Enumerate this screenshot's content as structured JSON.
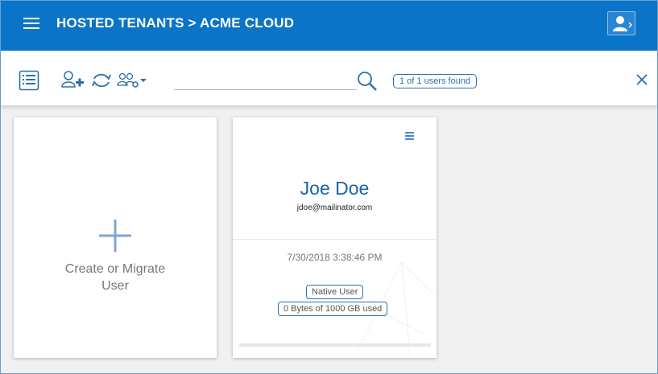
{
  "header": {
    "title": "HOSTED TENANTS > ACME CLOUD",
    "menu_icon": "hamburger-menu-icon",
    "user_icon": "user-account-icon"
  },
  "toolbar": {
    "icons": [
      "list-view-icon",
      "add-user-icon",
      "sync-icon",
      "group-settings-icon"
    ],
    "search": {
      "value": "",
      "placeholder": ""
    },
    "search_icon": "search-icon",
    "found_text": "1 of 1 users found",
    "close_icon": "close-icon"
  },
  "create_card": {
    "label_line1": "Create or Migrate",
    "label_line2": "User",
    "icon": "plus-icon"
  },
  "user_card": {
    "name": "Joe Doe",
    "email": "jdoe@mailinator.com",
    "date": "7/30/2018 3:38:46 PM",
    "type_badge": "Native User",
    "storage_badge": "0 Bytes of 1000 GB used",
    "menu_icon": "card-menu-icon"
  },
  "colors": {
    "header_bg": "#0a74c8",
    "accent": "#2a6fae",
    "name_text": "#1a64a8"
  }
}
